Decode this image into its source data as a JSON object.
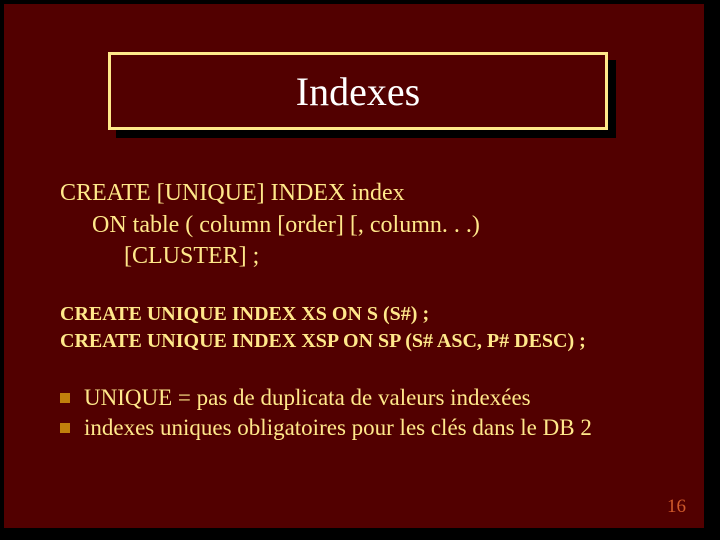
{
  "title": "Indexes",
  "syntax": {
    "l1": "CREATE [UNIQUE] INDEX index",
    "l2": "ON table ( column [order] [, column. . .)",
    "l3": "[CLUSTER] ;"
  },
  "examples": {
    "e1": "CREATE UNIQUE INDEX XS ON S (S#) ;",
    "e2": "CREATE UNIQUE INDEX XSP ON SP (S# ASC, P# DESC) ;"
  },
  "bullets": {
    "b1": "UNIQUE = pas de duplicata de valeurs indexées",
    "b2": "indexes uniques obligatoires pour les clés dans le DB 2"
  },
  "page_number": "16"
}
